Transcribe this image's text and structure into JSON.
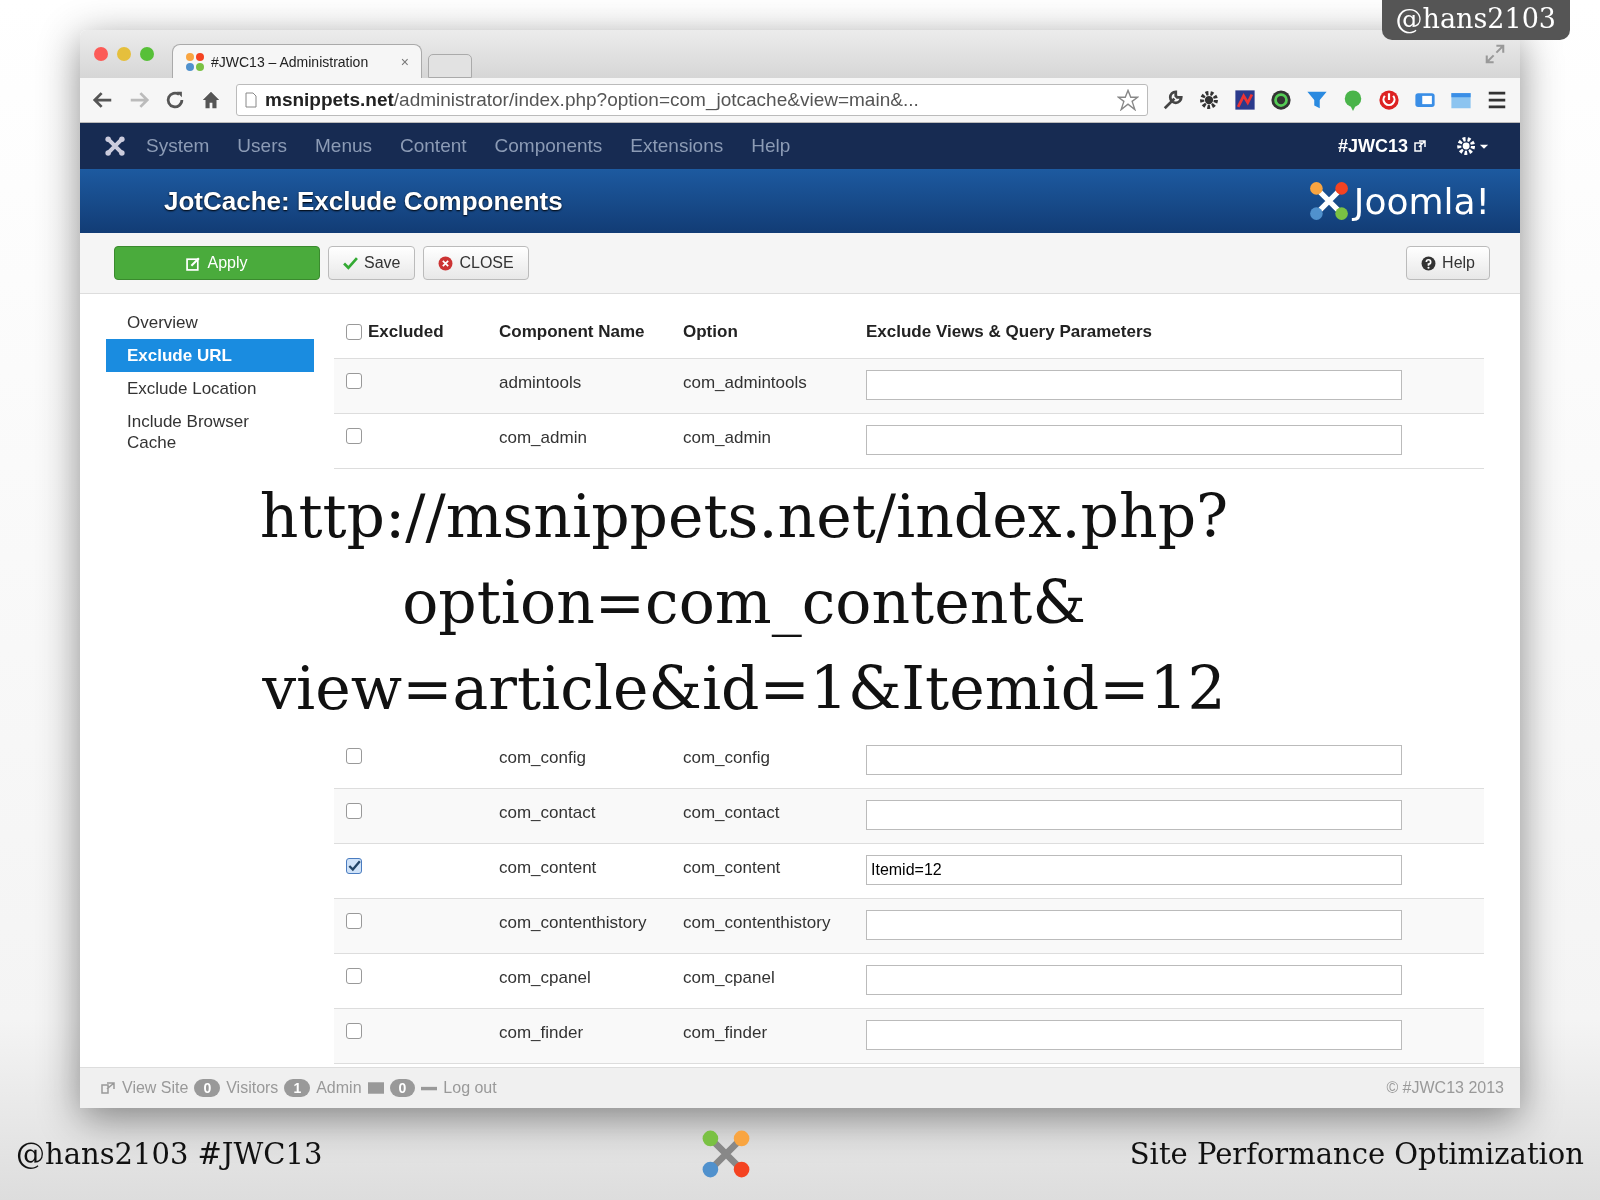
{
  "corner_badge": "@hans2103",
  "browser": {
    "tab_title": "#JWC13 – Administration",
    "tab_close": "×",
    "url_host": "msnippets.net",
    "url_path": "/administrator/index.php?option=com_jotcache&view=main&..."
  },
  "nav": {
    "items": [
      "System",
      "Users",
      "Menus",
      "Content",
      "Components",
      "Extensions",
      "Help"
    ],
    "site_link": "#JWC13"
  },
  "header": {
    "title": "JotCache: Exclude Components",
    "logo_text": "Joomla!"
  },
  "toolbar": {
    "buttons": [
      {
        "label": "Apply",
        "kind": "primary"
      },
      {
        "label": "Save",
        "kind": "save"
      },
      {
        "label": "CLOSE",
        "kind": "close"
      }
    ],
    "help": "Help"
  },
  "sidebar": [
    {
      "label": "Overview",
      "selected": false
    },
    {
      "label": "Exclude URL",
      "selected": true
    },
    {
      "label": "Exclude Location",
      "selected": false
    },
    {
      "label": "Include Browser Cache",
      "selected": false
    }
  ],
  "table": {
    "columns": [
      "Excluded",
      "Component Name",
      "Option",
      "Exclude Views & Query Parameters"
    ],
    "header_checked": false,
    "rows_top": [
      {
        "checked": false,
        "name": "admintools",
        "option": "com_admintools"
      },
      {
        "checked": false,
        "name": "com_admin",
        "option": "com_admin"
      }
    ],
    "rows_bottom": [
      {
        "checked": false,
        "name": "com_config",
        "option": "com_config"
      },
      {
        "checked": false,
        "name": "com_contact",
        "option": "com_contact"
      },
      {
        "checked": true,
        "name": "com_content",
        "option": "com_content",
        "value": "Itemid=12"
      },
      {
        "checked": false,
        "name": "com_contenthistory",
        "option": "com_contenthistory"
      },
      {
        "checked": false,
        "name": "com_cpanel",
        "option": "com_cpanel"
      },
      {
        "checked": false,
        "name": "com_finder",
        "option": "com_finder"
      }
    ]
  },
  "overlay_lines": [
    "http://msnippets.net/index.php?",
    "option=com_content&",
    "view=article&id=1&Itemid=12"
  ],
  "status_bar": {
    "view_site": "View Site",
    "visitors_count": "0",
    "visitors": "Visitors",
    "admin_count": "1",
    "admin": "Admin",
    "messages_count": "0",
    "logout": "Log out",
    "copyright": "© #JWC13 2013"
  },
  "footer": {
    "left": "@hans2103 #JWC13",
    "right": "Site Performance Optimization"
  }
}
